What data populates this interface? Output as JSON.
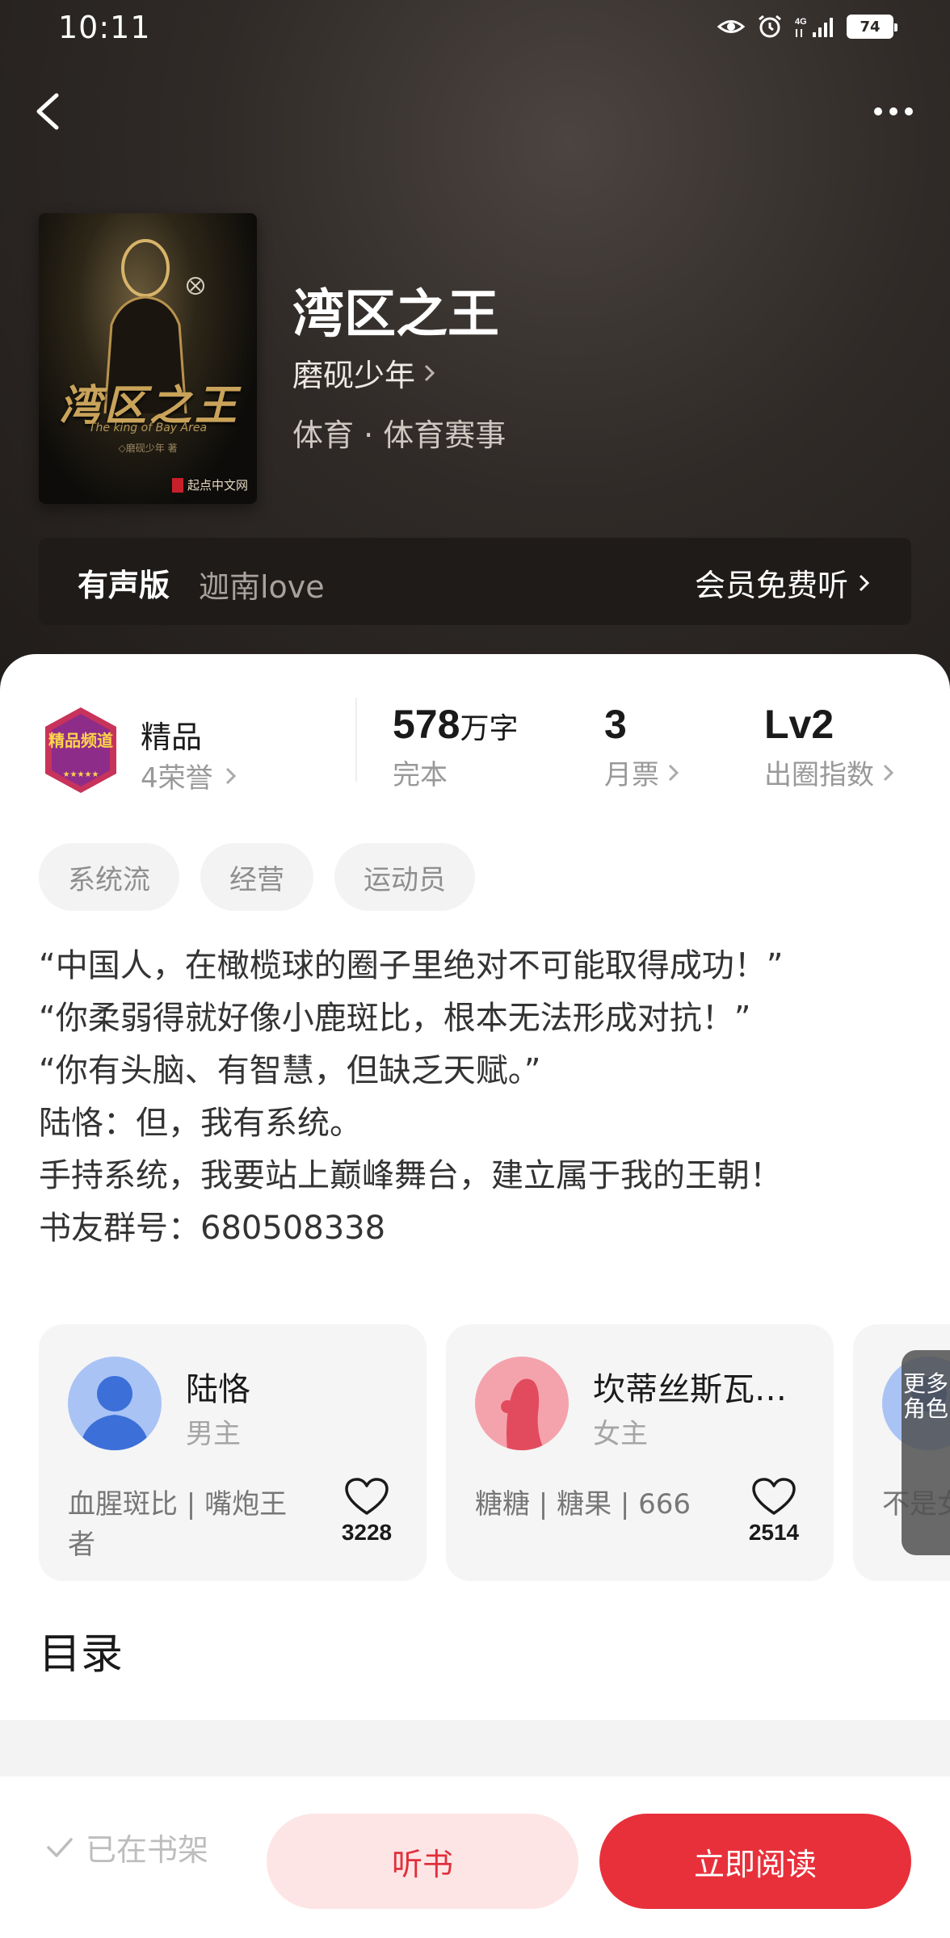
{
  "status_bar": {
    "time": "10:11",
    "network": "4G",
    "battery": "74"
  },
  "book": {
    "title": "湾区之王",
    "author": "磨砚少年",
    "genre": "体育 · 体育赛事",
    "cover": {
      "title": "湾区之王",
      "subtitle": "The king of Bay Area",
      "author": "◇磨砚少年 著",
      "publisher": "起点中文网"
    }
  },
  "audio": {
    "label": "有声版",
    "narrator": "迦南love",
    "cta": "会员免费听"
  },
  "honor": {
    "badge_text": "精品频道",
    "title": "精品",
    "subtitle": "4荣誉"
  },
  "stats": {
    "words": {
      "value": "578",
      "unit": "万字",
      "label": "完本"
    },
    "monthly_votes": {
      "value": "3",
      "label": "月票"
    },
    "influence": {
      "value": "Lv2",
      "label": "出圈指数"
    }
  },
  "tags": [
    "系统流",
    "经营",
    "运动员"
  ],
  "synopsis": [
    "“中国人，在橄榄球的圈子里绝对不可能取得成功！”",
    "“你柔弱得就好像小鹿斑比，根本无法形成对抗！”",
    "“你有头脑、有智慧，但缺乏天赋。”",
    "陆恪：但，我有系统。",
    "手持系统，我要站上巅峰舞台，建立属于我的王朝！",
    "书友群号：680508338"
  ],
  "characters": [
    {
      "name": "陆恪",
      "role": "男主",
      "tags": "血腥斑比 | 嘴炮王者",
      "likes": "3228"
    },
    {
      "name": "坎蒂丝斯瓦…",
      "role": "女主",
      "tags": "糖糖 | 糖果 | 666",
      "likes": "2514"
    },
    {
      "name": "",
      "role": "",
      "tags": "不是女 体质",
      "likes": ""
    }
  ],
  "more_roles_label": "更多角色",
  "toc_title": "目录",
  "bottom": {
    "on_shelf": "已在书架",
    "listen": "听书",
    "read": "立即阅读"
  },
  "colors": {
    "accent": "#e8303b",
    "accent_light": "#fde5e6",
    "hero_bg": "#2f2a27"
  }
}
